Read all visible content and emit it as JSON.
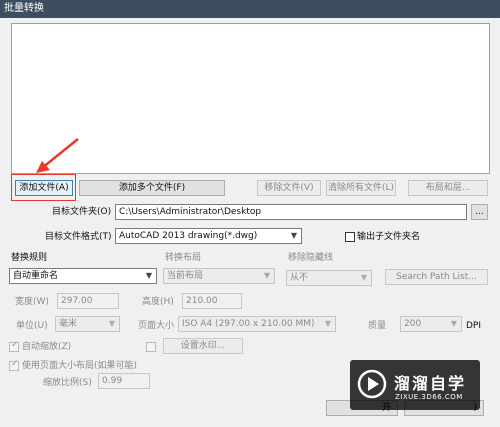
{
  "window": {
    "title": "批量转换"
  },
  "buttons": {
    "add_file": "添加文件(A)",
    "add_multiple": "添加多个文件(F)",
    "remove_file": "移除文件(V)",
    "clear_all": "清除所有文件(L)",
    "layout_and_layers": "布局和层...",
    "browse": "...",
    "set_watermark": "设置水印...",
    "search_path_list": "Search Path List...",
    "ok_partial": "开",
    "cancel_partial": ")"
  },
  "target_folder": {
    "label": "目标文件夹(O)",
    "value": "C:\\Users\\Administrator\\Desktop"
  },
  "target_format": {
    "label": "目标文件格式(T)",
    "value": "AutoCAD 2013 drawing(*.dwg)"
  },
  "output_subfolder": {
    "label": "输出子文件夹名",
    "checked": false
  },
  "replace_rule": {
    "label": "替换规则",
    "value": "自动重命名"
  },
  "convert_layout": {
    "label": "转换布局",
    "value": "当前布局"
  },
  "remove_hidden": {
    "label": "移除隐藏线",
    "value": "从不"
  },
  "width": {
    "label": "宽度(W)",
    "value": "297.00"
  },
  "height": {
    "label": "高度(H)",
    "value": "210.00"
  },
  "unit": {
    "label": "单位(U)",
    "value": "毫米"
  },
  "page_size": {
    "label": "页面大小",
    "value": "ISO A4 (297.00 x 210.00 MM)"
  },
  "quality": {
    "label": "质量",
    "value": "200",
    "unit": "DPI"
  },
  "auto_zoom": {
    "label": "自动缩放(Z)",
    "checked": true
  },
  "watermark_check": {
    "checked": false
  },
  "use_page_size": {
    "label": "使用页面大小布局(如果可能)",
    "checked": true
  },
  "zoom_ratio": {
    "label": "缩放比例(S)",
    "value": "0.99"
  },
  "watermark": {
    "brand": "溜溜自学",
    "url": "ZIXUE.3D66.COM"
  },
  "colors": {
    "annotation_red": "#e4392b",
    "title_bar": "#3d4e60"
  }
}
